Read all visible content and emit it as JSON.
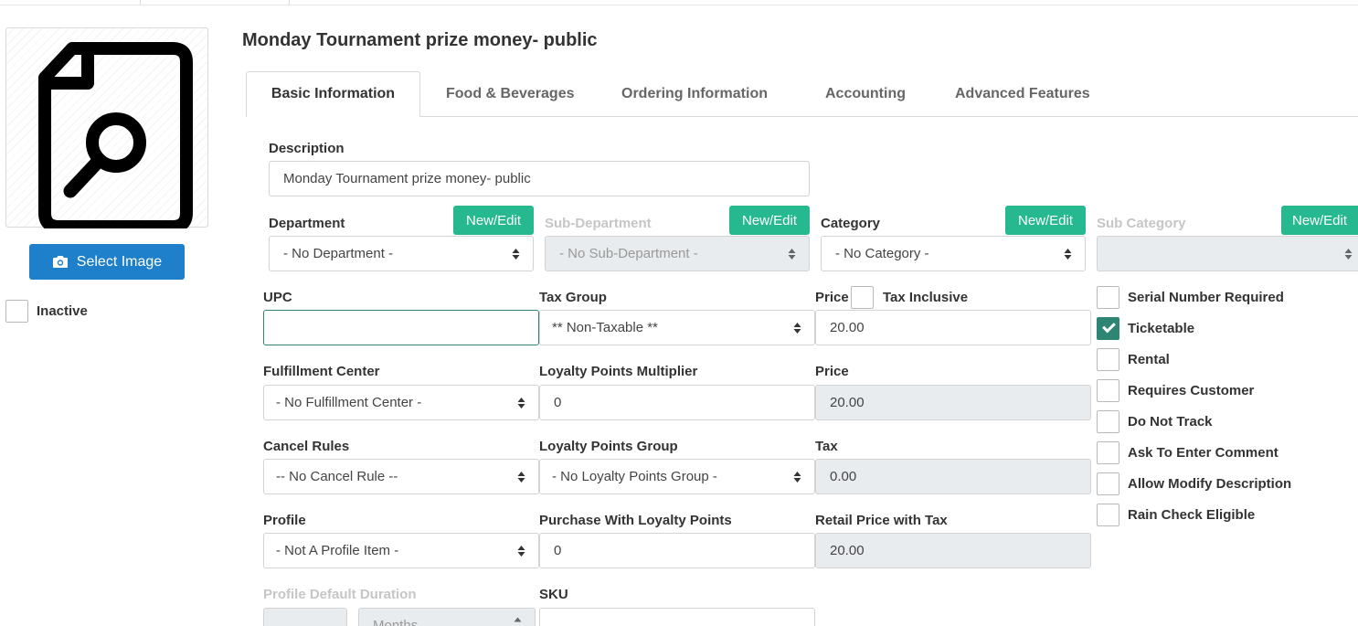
{
  "page": {
    "title": "Monday Tournament prize money- public"
  },
  "left": {
    "select_image_label": "Select Image",
    "inactive_label": "Inactive"
  },
  "tabs": [
    "Basic Information",
    "Food & Beverages",
    "Ordering Information",
    "Accounting",
    "Advanced Features"
  ],
  "form": {
    "description": {
      "label": "Description",
      "value": "Monday Tournament prize money- public"
    },
    "new_edit_label": "New/Edit",
    "department": {
      "label": "Department",
      "value": "- No Department -"
    },
    "sub_department": {
      "label": "Sub-Department",
      "value": "- No Sub-Department -"
    },
    "category": {
      "label": "Category",
      "value": "- No Category -"
    },
    "sub_category": {
      "label": "Sub Category",
      "value": ""
    },
    "upc": {
      "label": "UPC",
      "value": ""
    },
    "tax_group": {
      "label": "Tax Group",
      "value": "** Non-Taxable **"
    },
    "price": {
      "label": "Price",
      "value": "20.00",
      "tax_inclusive_label": "Tax Inclusive"
    },
    "fulfillment_center": {
      "label": "Fulfillment Center",
      "value": "- No Fulfillment Center -"
    },
    "loyalty_multiplier": {
      "label": "Loyalty Points Multiplier",
      "value": "0"
    },
    "price_readonly": {
      "label": "Price",
      "value": "20.00"
    },
    "cancel_rules": {
      "label": "Cancel Rules",
      "value": "-- No Cancel Rule --"
    },
    "loyalty_group": {
      "label": "Loyalty Points Group",
      "value": "- No Loyalty Points Group -"
    },
    "tax": {
      "label": "Tax",
      "value": "0.00"
    },
    "profile": {
      "label": "Profile",
      "value": "- Not A Profile Item -"
    },
    "purchase_loyalty": {
      "label": "Purchase With Loyalty Points",
      "value": "0"
    },
    "retail_price_tax": {
      "label": "Retail Price with Tax",
      "value": "20.00"
    },
    "profile_default_duration": {
      "label": "Profile Default Duration",
      "value": "",
      "unit": "Months"
    },
    "sku": {
      "label": "SKU",
      "value": ""
    }
  },
  "options": [
    {
      "label": "Serial Number Required",
      "checked": false
    },
    {
      "label": "Ticketable",
      "checked": true
    },
    {
      "label": "Rental",
      "checked": false
    },
    {
      "label": "Requires Customer",
      "checked": false
    },
    {
      "label": "Do Not Track",
      "checked": false
    },
    {
      "label": "Ask To Enter Comment",
      "checked": false
    },
    {
      "label": "Allow Modify Description",
      "checked": false
    },
    {
      "label": "Rain Check Eligible",
      "checked": false
    }
  ],
  "colors": {
    "primary": "#1e7fcb",
    "accent": "#26b88f",
    "check": "#2e8574"
  }
}
